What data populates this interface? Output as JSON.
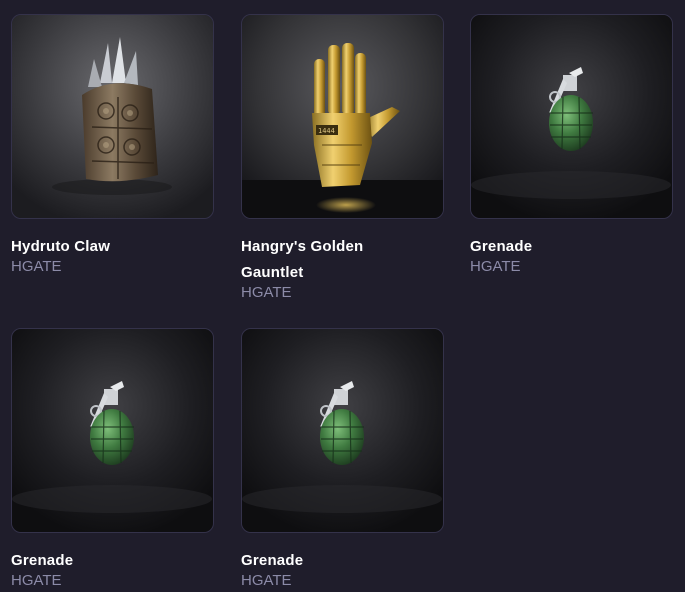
{
  "items": [
    {
      "title": "Hydruto Claw",
      "collection": "HGATE",
      "image": "claw-crown-icon"
    },
    {
      "title": "Hangry's Golden Gauntlet",
      "collection": "HGATE",
      "image": "golden-gauntlet-icon"
    },
    {
      "title": "Grenade",
      "collection": "HGATE",
      "image": "grenade-icon"
    },
    {
      "title": "Grenade",
      "collection": "HGATE",
      "image": "grenade-icon"
    },
    {
      "title": "Grenade",
      "collection": "HGATE",
      "image": "grenade-icon"
    }
  ],
  "colors": {
    "background": "#1f1d2b",
    "title": "#ffffff",
    "collection": "#8c8ba8",
    "card_border": "#34324a"
  }
}
